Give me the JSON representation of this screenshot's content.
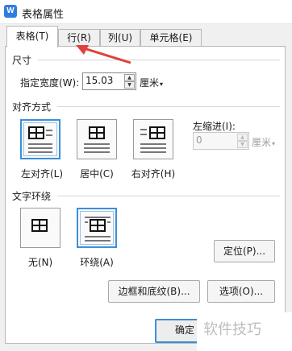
{
  "window": {
    "title": "表格属性",
    "app_icon_letter": "W"
  },
  "tabs": [
    {
      "label": "表格(T)",
      "active": true
    },
    {
      "label": "行(R)",
      "active": false
    },
    {
      "label": "列(U)",
      "active": false
    },
    {
      "label": "单元格(E)",
      "active": false
    }
  ],
  "size": {
    "section_label": "尺寸",
    "width_label": "指定宽度(W):",
    "width_value": "15.03",
    "unit": "厘米"
  },
  "alignment": {
    "section_label": "对齐方式",
    "options": [
      {
        "label": "左对齐(L)",
        "selected": true
      },
      {
        "label": "居中(C)",
        "selected": false
      },
      {
        "label": "右对齐(H)",
        "selected": false
      }
    ],
    "indent_label": "左缩进(I):",
    "indent_value": "0",
    "indent_unit": "厘米"
  },
  "wrap": {
    "section_label": "文字环绕",
    "options": [
      {
        "label": "无(N)",
        "selected": false
      },
      {
        "label": "环绕(A)",
        "selected": true
      }
    ]
  },
  "buttons": {
    "position": "定位(P)...",
    "borders": "边框和底纹(B)...",
    "options": "选项(O)...",
    "ok": "确定"
  },
  "watermark": "软件技巧",
  "colors": {
    "accent": "#3b8fd9",
    "arrow": "#e0413a"
  },
  "icons": {
    "unit_dropdown": "▾",
    "spin_up": "▲",
    "spin_down": "▼"
  }
}
